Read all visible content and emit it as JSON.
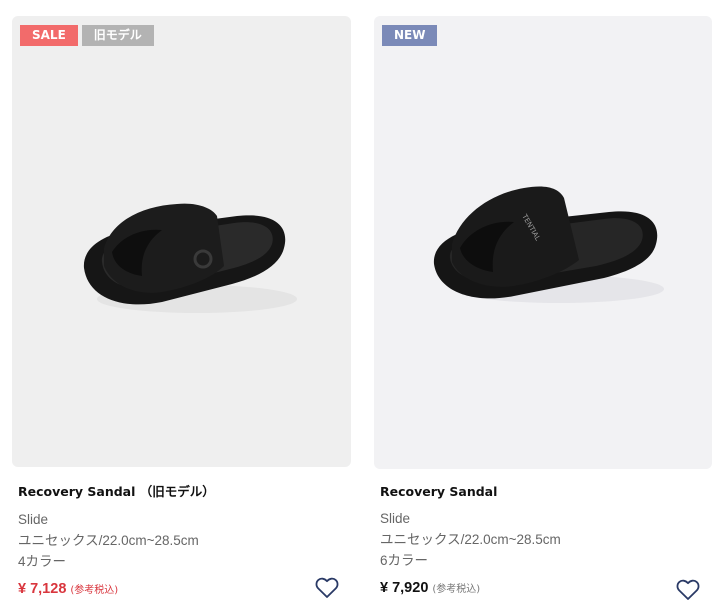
{
  "products": [
    {
      "badges": [
        "SALE",
        "旧モデル"
      ],
      "name": "Recovery Sandal （旧モデル）",
      "category": "Slide",
      "size": "ユニセックス/22.0cm~28.5cm",
      "colors": "4カラー",
      "price": "¥ 7,128",
      "tax_note": "(参考税込)"
    },
    {
      "badges": [
        "NEW"
      ],
      "name": "Recovery Sandal",
      "category": "Slide",
      "size": "ユニセックス/22.0cm~28.5cm",
      "colors": "6カラー",
      "price": "¥ 7,920",
      "tax_note": "(参考税込)"
    }
  ],
  "colors": {
    "sale_badge": "#f26b6b",
    "old_badge": "#b3b3b3",
    "new_badge": "#7b8ab8",
    "sale_price": "#d9363e"
  }
}
